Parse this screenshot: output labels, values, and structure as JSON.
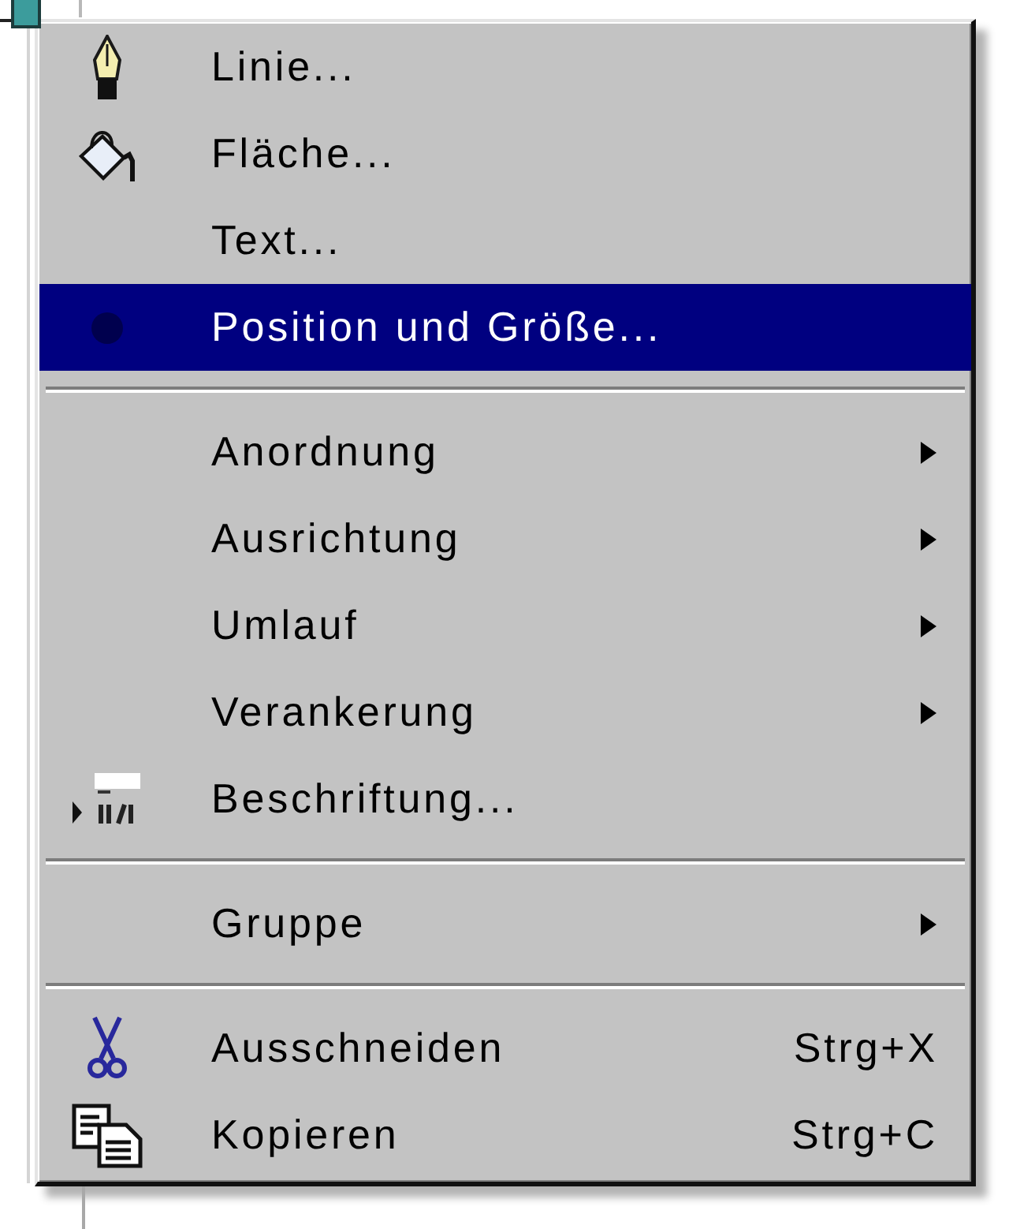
{
  "menu": {
    "items": [
      {
        "kind": "item",
        "label": "Linie...",
        "submenu": false,
        "selected": false
      },
      {
        "kind": "item",
        "label": "Fläche...",
        "submenu": false,
        "selected": false
      },
      {
        "kind": "item",
        "label": "Text...",
        "submenu": false,
        "selected": false
      },
      {
        "kind": "item",
        "label": "Position und Größe...",
        "submenu": false,
        "selected": true
      },
      {
        "kind": "separator"
      },
      {
        "kind": "item",
        "label": "Anordnung",
        "submenu": true,
        "selected": false
      },
      {
        "kind": "item",
        "label": "Ausrichtung",
        "submenu": true,
        "selected": false
      },
      {
        "kind": "item",
        "label": "Umlauf",
        "submenu": true,
        "selected": false
      },
      {
        "kind": "item",
        "label": "Verankerung",
        "submenu": true,
        "selected": false
      },
      {
        "kind": "item",
        "label": "Beschriftung...",
        "submenu": false,
        "selected": false
      },
      {
        "kind": "separator"
      },
      {
        "kind": "item",
        "label": "Gruppe",
        "submenu": true,
        "selected": false
      },
      {
        "kind": "separator"
      },
      {
        "kind": "item",
        "label": "Ausschneiden",
        "shortcut": "Strg+X",
        "submenu": false,
        "selected": false
      },
      {
        "kind": "item",
        "label": "Kopieren",
        "shortcut": "Strg+C",
        "submenu": false,
        "selected": false
      }
    ]
  }
}
